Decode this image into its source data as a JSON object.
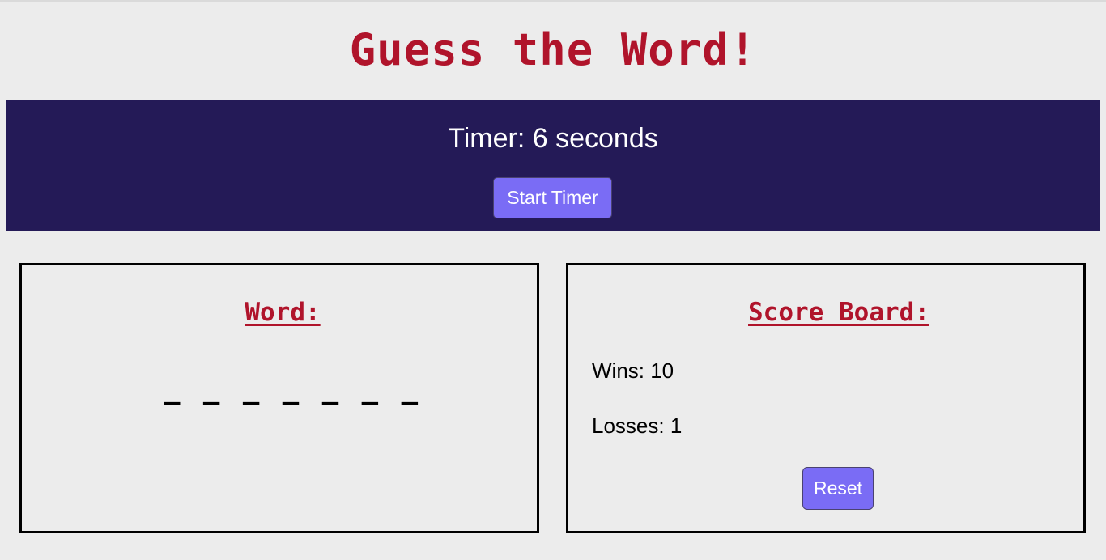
{
  "header": {
    "title": "Guess the Word!"
  },
  "timer": {
    "text": "Timer: 6 seconds",
    "start_label": "Start Timer"
  },
  "word_panel": {
    "heading": "Word:",
    "blanks": "_ _ _ _ _ _ _"
  },
  "score_panel": {
    "heading": "Score Board:",
    "wins": "Wins: 10",
    "losses": "Losses: 1",
    "reset_label": "Reset"
  },
  "colors": {
    "title": "#b0142b",
    "timer_band": "#241a57",
    "button": "#7a6cf5",
    "background": "#ececec"
  }
}
